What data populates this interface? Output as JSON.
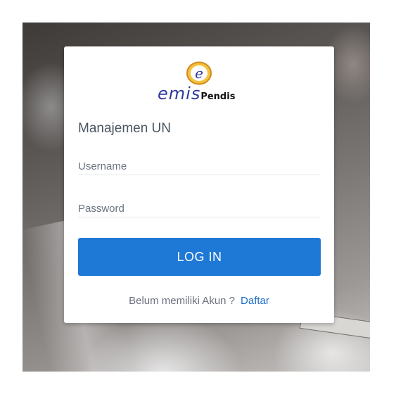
{
  "brand": {
    "logo_letter": "e",
    "name_primary": "emis",
    "name_secondary": "Pendis",
    "colors": {
      "primary": "#2f3a9e",
      "ring": "#e3a23a"
    }
  },
  "login": {
    "title": "Manajemen UN",
    "username_placeholder": "Username",
    "password_placeholder": "Password",
    "submit_label": "LOG IN",
    "signup_prompt": "Belum memiliki Akun ?",
    "signup_link": "Daftar"
  },
  "theme": {
    "button_color": "#1e78d6",
    "link_color": "#1e6fc8"
  }
}
